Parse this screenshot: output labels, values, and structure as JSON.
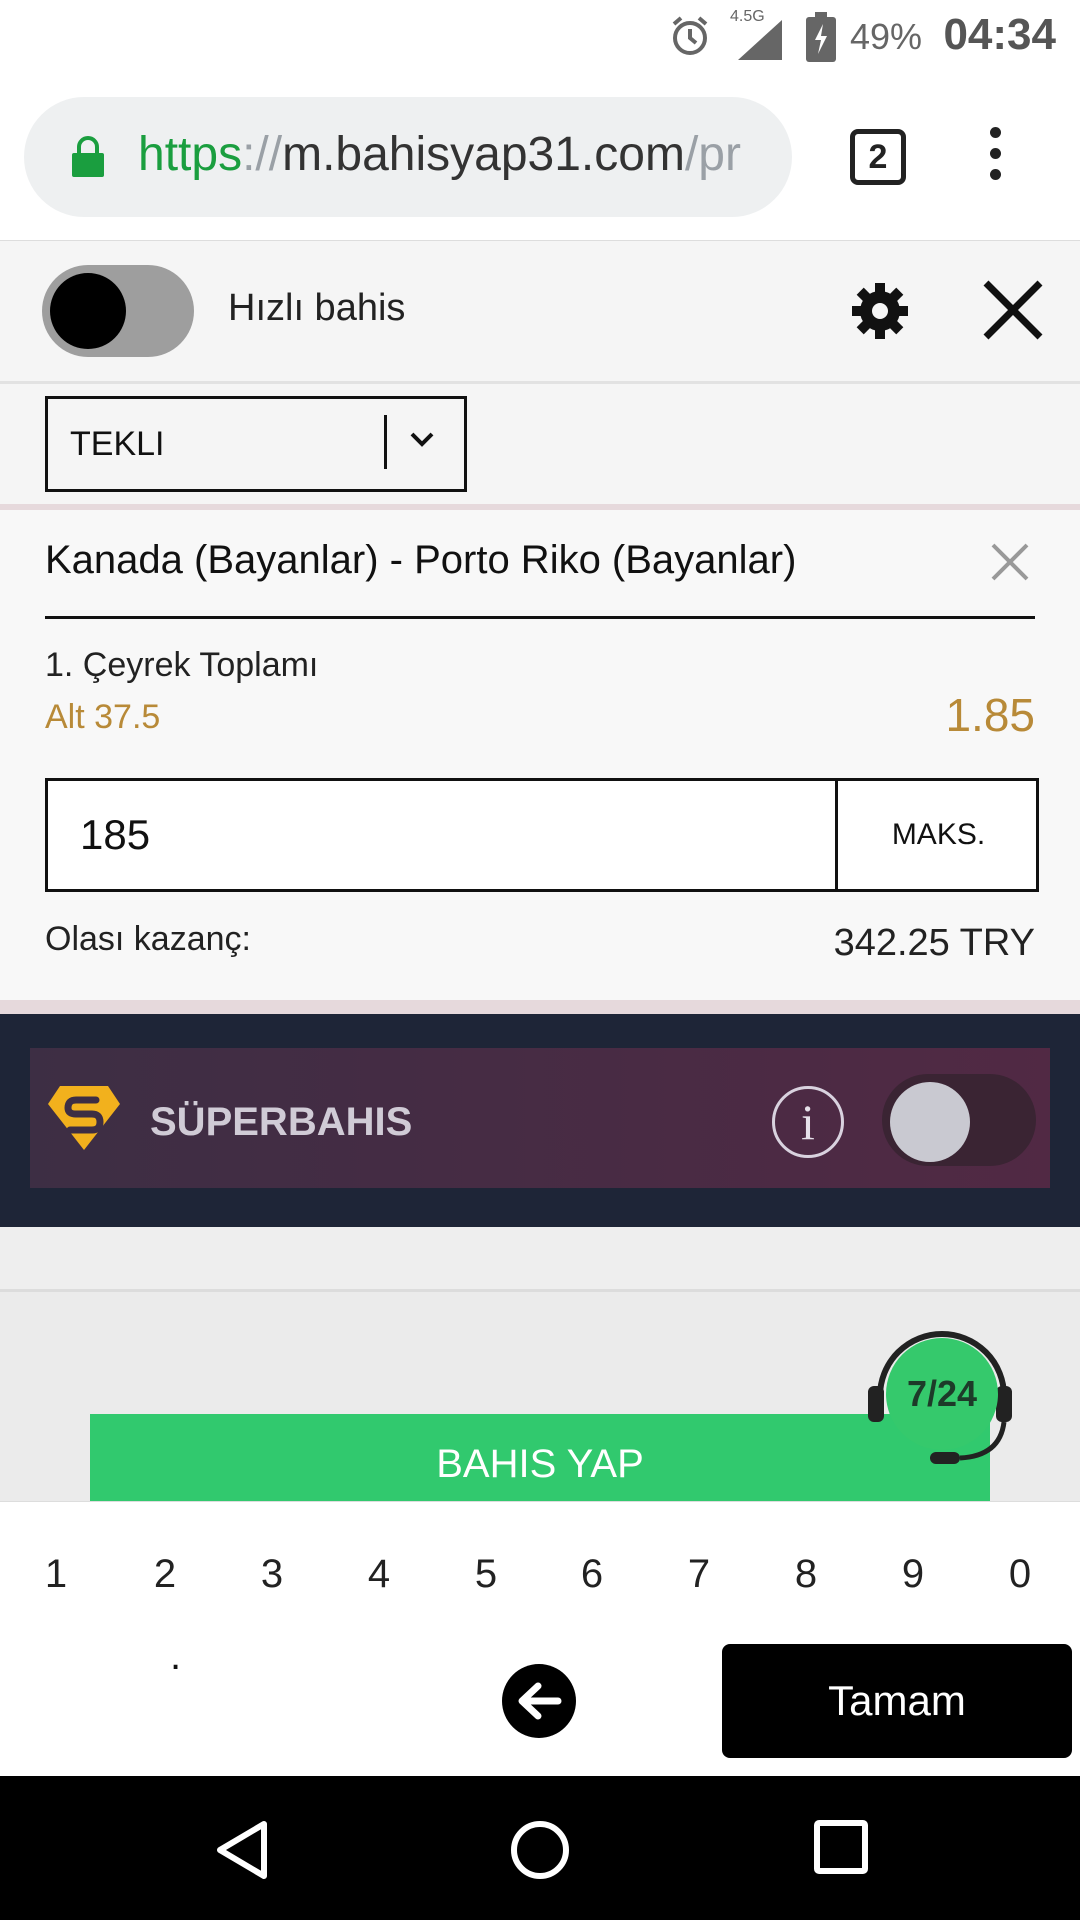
{
  "status_bar": {
    "network": "4.5G",
    "battery": "49%",
    "time": "04:34",
    "icons": [
      "alarm-icon",
      "signal-icon",
      "battery-icon"
    ]
  },
  "browser": {
    "url_scheme": "https",
    "url_sep": "://",
    "url_host": "m.bahisyap31.com",
    "url_path": "/pr",
    "tab_count": "2"
  },
  "betslip": {
    "quick_bet_label": "Hızlı bahis",
    "bet_type": "TEKLI",
    "event": "Kanada (Bayanlar) - Porto Riko (Bayanlar)",
    "market": "1. Çeyrek Toplamı",
    "selection": "Alt 37.5",
    "odds": "1.85",
    "stake": "185",
    "max_label": "MAKS.",
    "possible_win_label": "Olası kazanç:",
    "possible_win_value": "342.25 TRY",
    "superbahis_label": "SÜPERBAHIS",
    "info_glyph": "i",
    "place_bet_label": "BAHIS YAP",
    "support_badge": "7/24"
  },
  "keyboard": {
    "digits": [
      "1",
      "2",
      "3",
      "4",
      "5",
      "6",
      "7",
      "8",
      "9",
      "0"
    ],
    "dot": ".",
    "done": "Tamam"
  },
  "colors": {
    "accent_gold": "#b88a38",
    "place_bet_green": "#31c96e",
    "secure_green": "#1a9e3f",
    "superbahis_bg": "#1e2537"
  }
}
